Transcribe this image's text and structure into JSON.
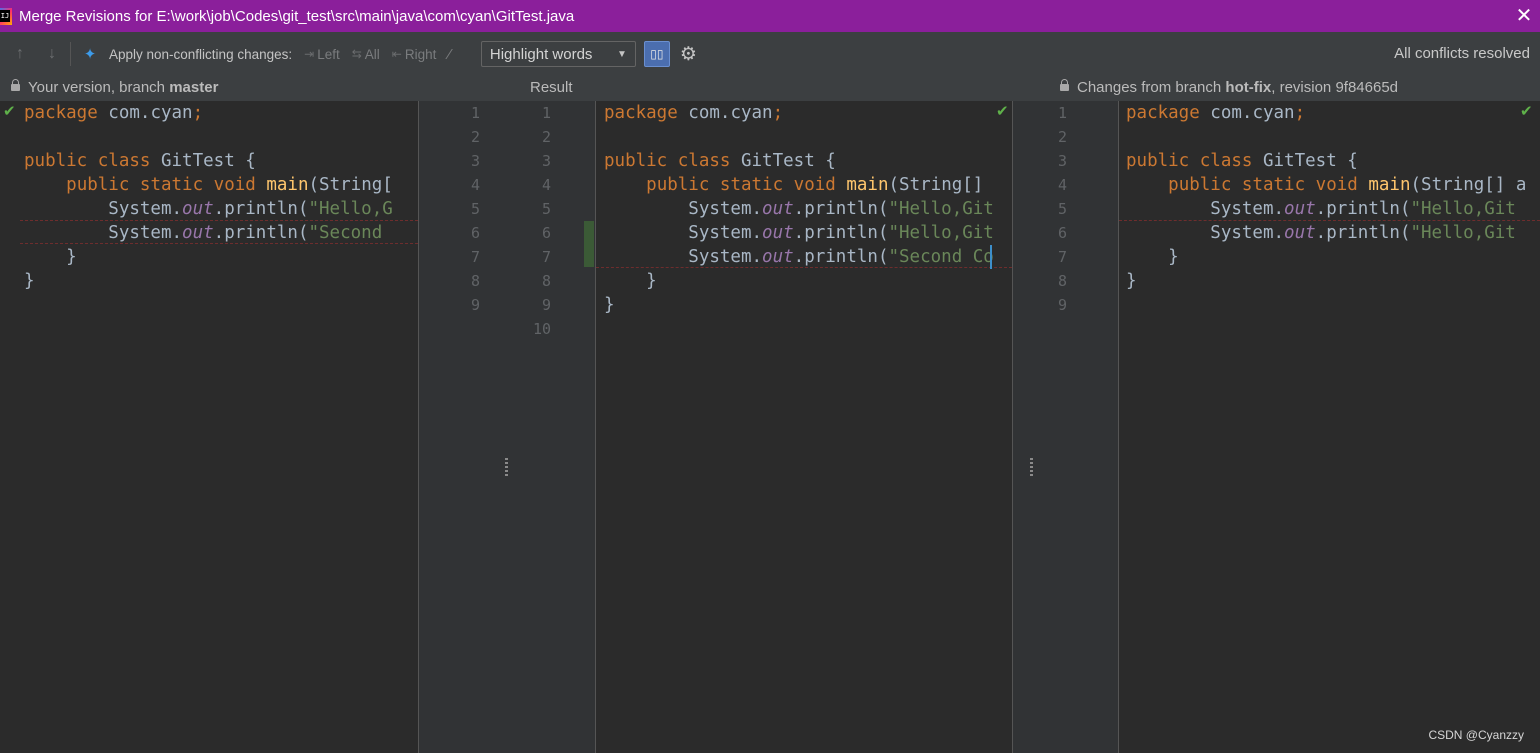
{
  "window": {
    "title": "Merge Revisions for E:\\work\\job\\Codes\\git_test\\src\\main\\java\\com\\cyan\\GitTest.java",
    "app_icon_text": "IJ",
    "close_glyph": "✕"
  },
  "toolbar": {
    "apply_label": "Apply non-conflicting changes:",
    "left_label": "Left",
    "all_label": "All",
    "right_label": "Right",
    "highlight_select": "Highlight words",
    "status": "All conflicts resolved",
    "icons": [
      "arrow-up-icon",
      "arrow-down-icon",
      "magic-resolve-icon",
      "apply-left-icon",
      "apply-all-icon",
      "apply-right-icon",
      "magic-wand-icon",
      "dropdown-arrow-icon",
      "sync-scroll-icon",
      "gear-icon"
    ]
  },
  "headers": {
    "left_prefix": "Your version, branch",
    "left_branch": "master",
    "center": "Result",
    "right_prefix": "Changes from branch",
    "right_branch": "hot-fix",
    "right_suffix": ", revision 9f84665d"
  },
  "gutter": {
    "left_numbers": [
      "1",
      "2",
      "3",
      "4",
      "5",
      "6",
      "7",
      "8",
      "9"
    ],
    "result_numbers": [
      "1",
      "2",
      "3",
      "4",
      "5",
      "6",
      "7",
      "8",
      "9",
      "10"
    ],
    "right_numbers": [
      "1",
      "2",
      "3",
      "4",
      "5",
      "6",
      "7",
      "8",
      "9"
    ]
  },
  "left_code": [
    [
      {
        "t": "package",
        "c": "kw"
      },
      {
        "t": " com.cyan"
      },
      {
        "t": ";",
        "c": "kw"
      }
    ],
    [],
    [
      {
        "t": "public class",
        "c": "kw"
      },
      {
        "t": " GitTest {"
      }
    ],
    [
      {
        "t": "    "
      },
      {
        "t": "public static void",
        "c": "kw"
      },
      {
        "t": " "
      },
      {
        "t": "main",
        "c": "fn"
      },
      {
        "t": "(String["
      }
    ],
    [
      {
        "t": "        System."
      },
      {
        "t": "out",
        "c": "fld"
      },
      {
        "t": ".println("
      },
      {
        "t": "\"Hello,G",
        "c": "str"
      }
    ],
    [
      {
        "t": "        System."
      },
      {
        "t": "out",
        "c": "fld"
      },
      {
        "t": ".println("
      },
      {
        "t": "\"Second ",
        "c": "str"
      }
    ],
    [
      {
        "t": "    }"
      }
    ],
    [
      {
        "t": "}"
      }
    ]
  ],
  "result_code": [
    [
      {
        "t": "package",
        "c": "kw"
      },
      {
        "t": " com.cyan"
      },
      {
        "t": ";",
        "c": "kw"
      }
    ],
    [],
    [
      {
        "t": "public class",
        "c": "kw"
      },
      {
        "t": " GitTest {"
      }
    ],
    [
      {
        "t": "    "
      },
      {
        "t": "public static void",
        "c": "kw"
      },
      {
        "t": " "
      },
      {
        "t": "main",
        "c": "fn"
      },
      {
        "t": "(String[]"
      }
    ],
    [
      {
        "t": "        System."
      },
      {
        "t": "out",
        "c": "fld"
      },
      {
        "t": ".println("
      },
      {
        "t": "\"Hello,Git",
        "c": "str"
      }
    ],
    [
      {
        "t": "        System."
      },
      {
        "t": "out",
        "c": "fld"
      },
      {
        "t": ".println("
      },
      {
        "t": "\"Hello,Git",
        "c": "str"
      }
    ],
    [
      {
        "t": "        System."
      },
      {
        "t": "out",
        "c": "fld"
      },
      {
        "t": ".println("
      },
      {
        "t": "\"Second Co",
        "c": "str"
      }
    ],
    [
      {
        "t": "    }"
      }
    ],
    [
      {
        "t": "}"
      }
    ]
  ],
  "right_code": [
    [
      {
        "t": "package",
        "c": "kw"
      },
      {
        "t": " com.cyan"
      },
      {
        "t": ";",
        "c": "kw"
      }
    ],
    [],
    [
      {
        "t": "public class",
        "c": "kw"
      },
      {
        "t": " GitTest {"
      }
    ],
    [
      {
        "t": "    "
      },
      {
        "t": "public static void",
        "c": "kw"
      },
      {
        "t": " "
      },
      {
        "t": "main",
        "c": "fn"
      },
      {
        "t": "(String[] a"
      }
    ],
    [
      {
        "t": "        System."
      },
      {
        "t": "out",
        "c": "fld"
      },
      {
        "t": ".println("
      },
      {
        "t": "\"Hello,Git",
        "c": "str"
      }
    ],
    [
      {
        "t": "        System."
      },
      {
        "t": "out",
        "c": "fld"
      },
      {
        "t": ".println("
      },
      {
        "t": "\"Hello,Git",
        "c": "str"
      }
    ],
    [
      {
        "t": "    }"
      }
    ],
    [
      {
        "t": "}"
      }
    ]
  ],
  "watermark": "CSDN @Cyanzzy",
  "colors": {
    "titlebar": "#8b1f9b",
    "keyword": "#cc7832",
    "method": "#ffc66d",
    "string": "#6a8759",
    "field": "#9876aa",
    "resolved_check": "#5fb14a"
  }
}
